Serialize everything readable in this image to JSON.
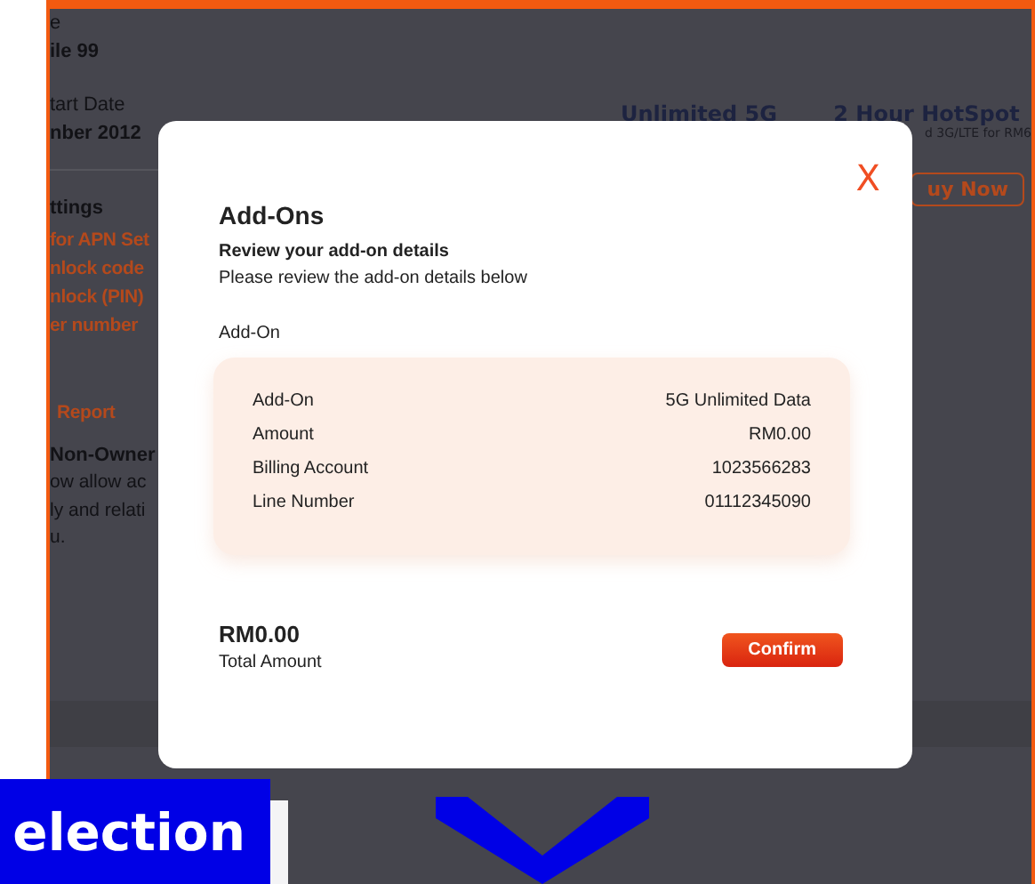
{
  "page": {
    "plan_label": "e",
    "plan_name": "ile 99",
    "start_label": "tart Date",
    "start_date": "nber 2012",
    "settings_title": "ttings",
    "settings_links": [
      "for APN Set",
      "nlock code",
      "nlock (PIN)",
      "er number"
    ],
    "report_link": "Report",
    "non_owner_title": "Non-Owner",
    "non_owner_lines": [
      "ow allow ac",
      "ly and relati",
      "u."
    ]
  },
  "offers": [
    {
      "title": "Unlimited 5G"
    },
    {
      "title": "2 Hour HotSpot",
      "subtitle": "d 3G/LTE for RM6",
      "button": "uy Now"
    }
  ],
  "modal": {
    "close": "X",
    "title": "Add-Ons",
    "subtitle": "Review your add-on details",
    "description": "Please review the add-on details below",
    "section_label": "Add-On",
    "details": [
      {
        "label": "Add-On",
        "value": "5G Unlimited Data"
      },
      {
        "label": "Amount",
        "value": "RM0.00"
      },
      {
        "label": "Billing Account",
        "value": "1023566283"
      },
      {
        "label": "Line Number",
        "value": "01112345090"
      }
    ],
    "total": "RM0.00",
    "total_label": "Total Amount",
    "confirm": "Confirm"
  },
  "banner": {
    "text": "election"
  }
}
